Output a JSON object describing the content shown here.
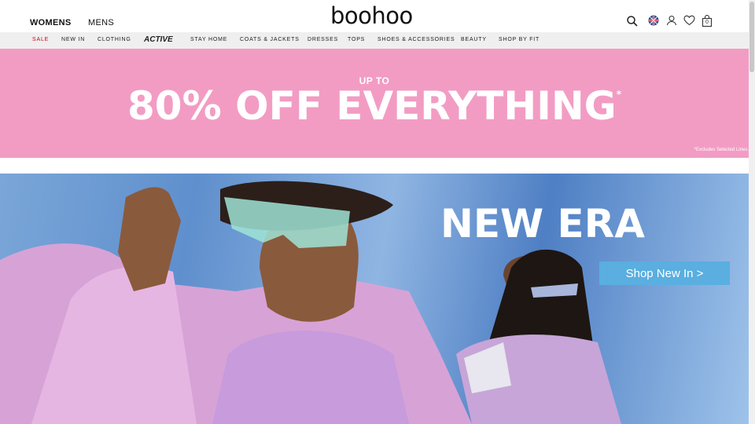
{
  "header": {
    "womens_label": "WOMENS",
    "mens_label": "MENS",
    "logo_text": "boohoo",
    "icons": [
      "search-icon",
      "flag-uk-icon",
      "account-icon",
      "wishlist-heart-icon",
      "bag-icon"
    ],
    "bag_count": "0"
  },
  "nav": {
    "items": [
      "SALE",
      "NEW IN",
      "CLOTHING",
      "ACTIVE",
      "STAY HOME",
      "COATS & JACKETS",
      "DRESSES",
      "TOPS",
      "SHOES & ACCESSORIES",
      "BEAUTY",
      "SHOP BY FIT"
    ]
  },
  "promo": {
    "upto": "UP TO",
    "headline": "80% OFF EVERYTHING",
    "asterisk": "*",
    "fineprint": "*Excludes Selected Lines.",
    "background": "#f29cc4"
  },
  "hero": {
    "title": "NEW ERA",
    "cta_label": "Shop New In >",
    "cta_color": "#5aaee0"
  }
}
